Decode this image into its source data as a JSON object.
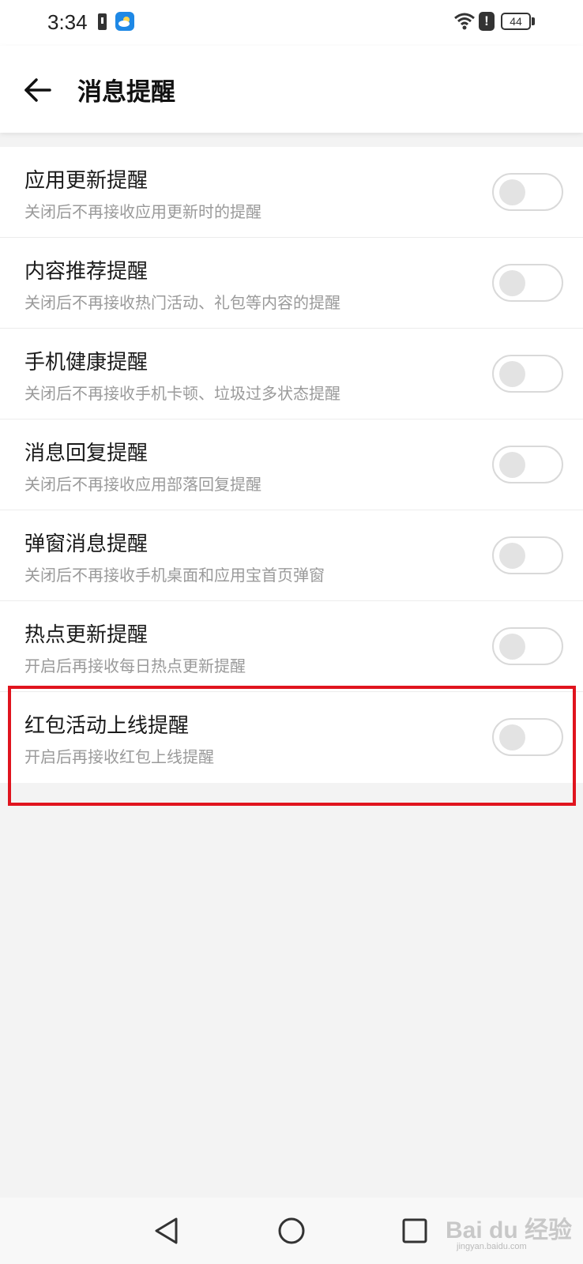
{
  "status_bar": {
    "time": "3:34",
    "battery_level": "44",
    "icons": [
      "battery-saver-icon",
      "weather-icon",
      "wifi-icon",
      "alert-icon",
      "battery-icon"
    ]
  },
  "header": {
    "title": "消息提醒",
    "back_icon": "arrow-left-icon"
  },
  "settings": [
    {
      "title": "应用更新提醒",
      "subtitle": "关闭后不再接收应用更新时的提醒",
      "enabled": false
    },
    {
      "title": "内容推荐提醒",
      "subtitle": "关闭后不再接收热门活动、礼包等内容的提醒",
      "enabled": false
    },
    {
      "title": "手机健康提醒",
      "subtitle": "关闭后不再接收手机卡顿、垃圾过多状态提醒",
      "enabled": false
    },
    {
      "title": "消息回复提醒",
      "subtitle": "关闭后不再接收应用部落回复提醒",
      "enabled": false
    },
    {
      "title": "弹窗消息提醒",
      "subtitle": "关闭后不再接收手机桌面和应用宝首页弹窗",
      "enabled": false
    },
    {
      "title": "热点更新提醒",
      "subtitle": "开启后再接收每日热点更新提醒",
      "enabled": false
    },
    {
      "title": "红包活动上线提醒",
      "subtitle": "开启后再接收红包上线提醒",
      "enabled": false
    }
  ],
  "annotation": {
    "highlight_color": "#e0141e",
    "highlighted_item": "红包活动上线提醒"
  },
  "nav_bar": {
    "icons": [
      "back-triangle-icon",
      "home-circle-icon",
      "recents-square-icon"
    ]
  },
  "watermark": {
    "main": "Bai du 经验",
    "sub": "jingyan.baidu.com"
  },
  "colors": {
    "background": "#f3f3f3",
    "surface": "#ffffff",
    "subtitle_text": "#9a9a9a",
    "toggle_off": "#e3e3e3"
  }
}
